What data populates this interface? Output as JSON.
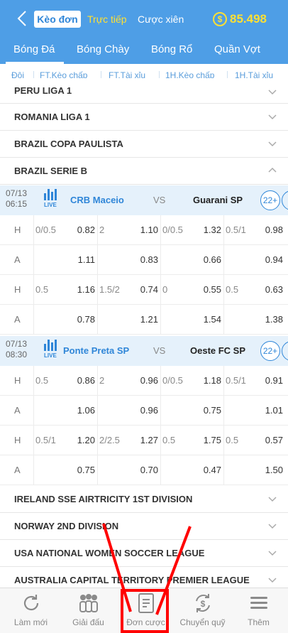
{
  "header": {
    "tab_active": "Kèo đơn",
    "tab_live": "Trực tiếp",
    "tab_parlay": "Cược xiên",
    "balance_icon": "$",
    "balance": "85.498"
  },
  "sports": [
    "Bóng Đá",
    "Bóng Chày",
    "Bóng Rổ",
    "Quần Vợt"
  ],
  "markets": [
    "Đội",
    "FT.Kèo chấp",
    "FT.Tài xỉu",
    "1H.Kèo chấp",
    "1H.Tài xỉu"
  ],
  "leagues_top": [
    "PERU LIGA 1",
    "ROMANIA LIGA 1",
    "BRAZIL COPA PAULISTA",
    "BRAZIL SERIE B"
  ],
  "matches": [
    {
      "date": "07/13",
      "time": "06:15",
      "live": "LIVE",
      "home": "CRB Maceio",
      "vs": "VS",
      "away": "Guarani SP",
      "more": "22+",
      "rows": [
        {
          "label": "H",
          "c1": "0/0.5",
          "o1": "0.82",
          "c2": "2",
          "o2": "1.10",
          "c3": "0/0.5",
          "o3": "1.32",
          "c4": "0.5/1",
          "o4": "0.98"
        },
        {
          "label": "A",
          "c1": "",
          "o1": "1.11",
          "c2": "",
          "o2": "0.83",
          "c3": "",
          "o3": "0.66",
          "c4": "",
          "o4": "0.94"
        },
        {
          "label": "H",
          "c1": "0.5",
          "o1": "1.16",
          "c2": "1.5/2",
          "o2": "0.74",
          "c3": "0",
          "o3": "0.55",
          "c4": "0.5",
          "o4": "0.63"
        },
        {
          "label": "A",
          "c1": "",
          "o1": "0.78",
          "c2": "",
          "o2": "1.21",
          "c3": "",
          "o3": "1.54",
          "c4": "",
          "o4": "1.38"
        }
      ]
    },
    {
      "date": "07/13",
      "time": "08:30",
      "live": "LIVE",
      "home": "Ponte Preta SP",
      "vs": "VS",
      "away": "Oeste FC SP",
      "more": "22+",
      "rows": [
        {
          "label": "H",
          "c1": "0.5",
          "o1": "0.86",
          "c2": "2",
          "o2": "0.96",
          "c3": "0/0.5",
          "o3": "1.18",
          "c4": "0.5/1",
          "o4": "0.91"
        },
        {
          "label": "A",
          "c1": "",
          "o1": "1.06",
          "c2": "",
          "o2": "0.96",
          "c3": "",
          "o3": "0.75",
          "c4": "",
          "o4": "1.01"
        },
        {
          "label": "H",
          "c1": "0.5/1",
          "o1": "1.20",
          "c2": "2/2.5",
          "o2": "1.27",
          "c3": "0.5",
          "o3": "1.75",
          "c4": "0.5",
          "o4": "0.57"
        },
        {
          "label": "A",
          "c1": "",
          "o1": "0.75",
          "c2": "",
          "o2": "0.70",
          "c3": "",
          "o3": "0.47",
          "c4": "",
          "o4": "1.50"
        }
      ]
    }
  ],
  "leagues_bottom": [
    "IRELAND SSE AIRTRICITY 1ST DIVISION",
    "NORWAY 2ND DIVISION",
    "USA NATIONAL WOMEN SOCCER LEAGUE",
    "AUSTRALIA CAPITAL TERRITORY PREMIER LEAGUE"
  ],
  "bottom_nav": [
    {
      "label": "Làm mới",
      "icon": "refresh-icon"
    },
    {
      "label": "Giải đấu",
      "icon": "tournament-icon"
    },
    {
      "label": "Đơn cược",
      "icon": "bet-slip-icon"
    },
    {
      "label": "Chuyển quỹ",
      "icon": "transfer-funds-icon"
    },
    {
      "label": "Thêm",
      "icon": "menu-icon"
    }
  ],
  "colors": {
    "header_bg": "#4e9ee6",
    "accent_blue": "#2f86d8",
    "live_yellow": "#ffe033",
    "match_header_bg": "#e5f1fb",
    "annotation_red": "#ff0000"
  }
}
